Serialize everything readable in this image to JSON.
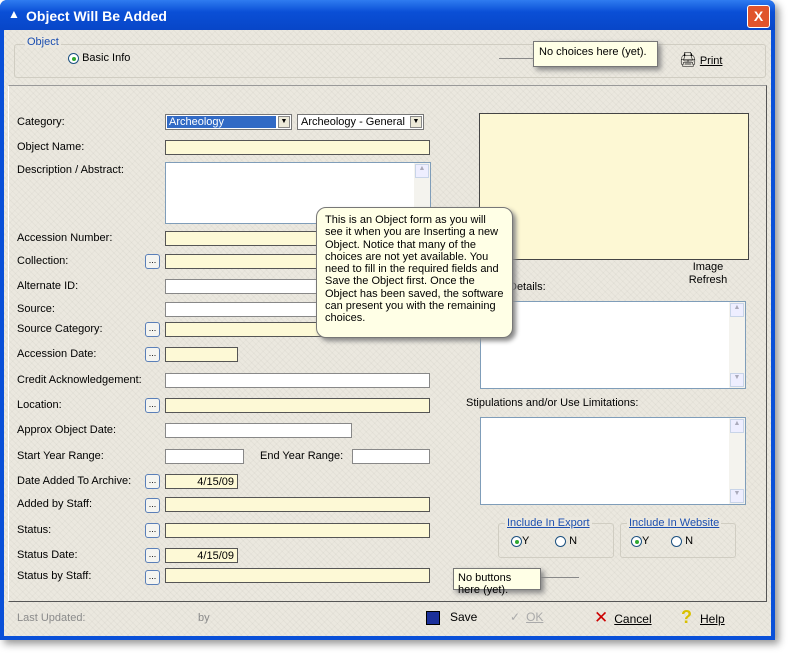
{
  "window": {
    "title": "Object Will Be Added",
    "close": "X"
  },
  "top": {
    "group_label": "Object",
    "radio_basic": "Basic Info",
    "tip": "No choices here (yet).",
    "print": "Print"
  },
  "form": {
    "category": {
      "label": "Category:",
      "value": "Archeology",
      "sub_value": "Archeology - General"
    },
    "object_name": {
      "label": "Object Name:",
      "value": ""
    },
    "description": {
      "label": "Description / Abstract:",
      "value": ""
    },
    "accession_number": {
      "label": "Accession Number:"
    },
    "collection": {
      "label": "Collection:"
    },
    "alternate_id": {
      "label": "Alternate ID:"
    },
    "source": {
      "label": "Source:"
    },
    "source_category": {
      "label": "Source Category:"
    },
    "accession_date": {
      "label": "Accession Date:"
    },
    "credit": {
      "label": "Credit Acknowledgement:"
    },
    "location": {
      "label": "Location:"
    },
    "approx_date": {
      "label": "Approx Object Date:"
    },
    "start_year": {
      "label": "Start Year Range:"
    },
    "end_year": {
      "label": "End Year Range:"
    },
    "date_added": {
      "label": "Date Added To Archive:",
      "value": "4/15/09"
    },
    "added_by": {
      "label": "Added by Staff:"
    },
    "status": {
      "label": "Status:"
    },
    "status_date": {
      "label": "Status Date:",
      "value": "4/15/09"
    },
    "status_by": {
      "label": "Status by Staff:"
    },
    "browse": "..."
  },
  "right": {
    "image_refresh": "Image Refresh",
    "details_label": "Details:",
    "stipulations_label": "Stipulations and/or Use Limitations:",
    "export": {
      "label": "Include In Export",
      "y": "Y",
      "n": "N",
      "selected": "Y"
    },
    "website": {
      "label": "Include In Website",
      "y": "Y",
      "n": "N",
      "selected": "Y"
    },
    "tip_buttons": "No buttons here (yet)."
  },
  "tooltip": "This is an Object form as you will see it when you are Inserting a new Object. Notice that many of the choices are not yet available. You need to fill in the required fields and Save the Object first. Once the Object has been saved, the software can present you with the remaining choices.",
  "footer": {
    "last_updated": "Last Updated:",
    "by": "by",
    "save": "Save",
    "ok": "OK",
    "cancel": "Cancel",
    "help": "Help"
  }
}
